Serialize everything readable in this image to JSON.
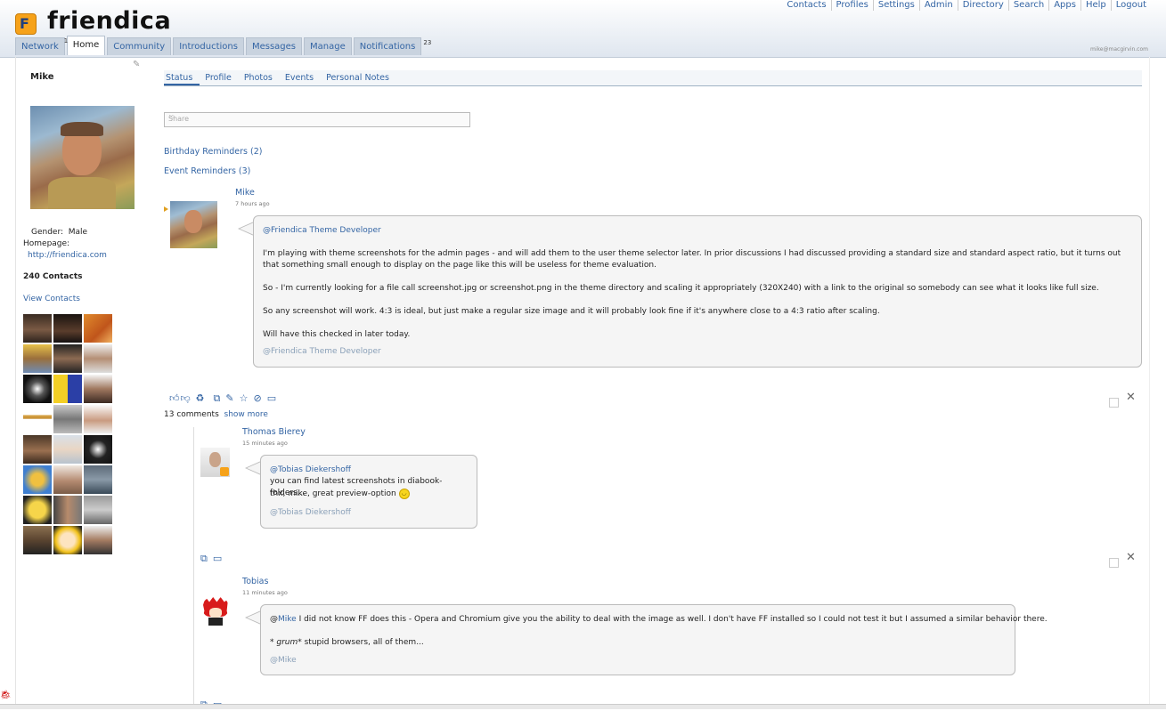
{
  "brand": {
    "name": "friendica",
    "logo_glyph": "F"
  },
  "top_links": [
    "Contacts",
    "Profiles",
    "Settings",
    "Admin",
    "Directory",
    "Search",
    "Apps",
    "Help",
    "Logout"
  ],
  "tabs": [
    {
      "label": "Network",
      "active": false
    },
    {
      "label": "Home",
      "active": true
    },
    {
      "label": "Community",
      "active": false
    },
    {
      "label": "Introductions",
      "active": false
    },
    {
      "label": "Messages",
      "active": false
    },
    {
      "label": "Manage",
      "active": false
    },
    {
      "label": "Notifications",
      "active": false
    }
  ],
  "badges": {
    "home": "1",
    "notifications": "23"
  },
  "user_email": "mike@macgirvin.com",
  "profile": {
    "name": "Mike",
    "gender_label": "Gender:",
    "gender_value": "Male",
    "homepage_label": "Homepage:",
    "homepage_url": "http://friendica.com",
    "contacts_count": "240 Contacts",
    "view_contacts": "View Contacts"
  },
  "subtabs": [
    "Status",
    "Profile",
    "Photos",
    "Events",
    "Personal Notes"
  ],
  "share_placeholder": "Share",
  "reminders": {
    "birthday": "Birthday Reminders (2)",
    "event": "Event Reminders (3)"
  },
  "post": {
    "author": "Mike",
    "ago": "7 hours ago",
    "mention": "@Friendica Theme Developer",
    "para1": "I'm playing with theme screenshots for the admin pages - and will add them to the user theme selector later. In prior discussions I had discussed providing a standard size and standard aspect ratio, but it turns out that something small enough to display on the page like this will be useless for theme evaluation.",
    "para2": "So - I'm currently looking for a file call screenshot.jpg or screenshot.png in the theme directory and scaling it appropriately (320X240) with a link to the original so somebody can see what it looks like full size.",
    "para3": "So any screenshot will work. 4:3 is ideal, but just make a regular size image and it will probably look fine if it's anywhere close to a 4:3 ratio after scaling.",
    "para4": "Will have this checked in later today.",
    "tag_prefix": "@",
    "tag": "Friendica Theme Developer",
    "comments_count": "13 comments",
    "show_more": "show more"
  },
  "comments": [
    {
      "author": "Thomas Bierey",
      "ago": "15 minutes ago",
      "mention": "@Tobias Diekershoff",
      "line1": "you can find latest screenshots in diabook-folders...",
      "line2": "thx, mike, great preview-option",
      "tag_prefix": "@",
      "tag": "Tobias Diekershoff"
    },
    {
      "author": "Tobias",
      "ago": "11 minutes ago",
      "mention_prefix": "@",
      "mention": "Mike",
      "line1": " I did not know FF does this - Opera and Chromium give you the ability to deal with the image as well. I don't have FF installed so I could not test it but I assumed a similar behavior there.",
      "line2_em": "* grum*",
      "line2_rest": " stupid browsers, all of them...",
      "tag_prefix": "@",
      "tag": "Mike"
    }
  ],
  "icons": {
    "like": "thumbs-up-icon",
    "dislike": "thumbs-down-icon",
    "share": "recycle-icon",
    "link": "external-link-icon",
    "edit": "pencil-icon",
    "star": "star-icon",
    "tag": "tag-icon",
    "file": "folder-icon",
    "close": "close-icon",
    "smiley": "smiley-icon"
  },
  "colors": {
    "link": "#3465a4",
    "tab_bg": "#c9d3df",
    "logo": "#f6a21a"
  }
}
